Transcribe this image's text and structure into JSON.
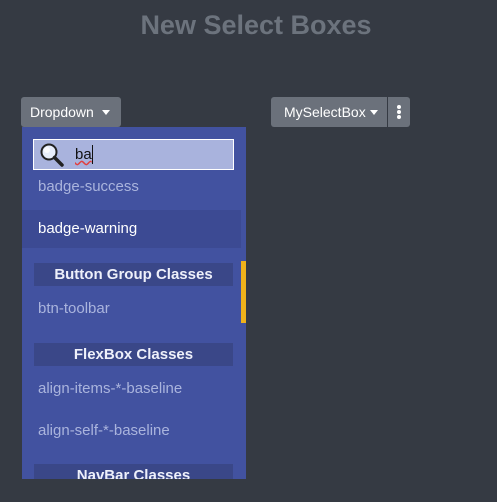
{
  "page": {
    "title": "New Select Boxes"
  },
  "buttons": {
    "dropdown_label": "Dropdown",
    "myselectbox_label": "MySelectBox"
  },
  "dropdown_menu": {
    "search_value": "ba",
    "items": [
      {
        "label": "badge-success",
        "type": "item"
      },
      {
        "label": "badge-warning",
        "type": "item",
        "highlighted": true
      },
      {
        "label": "Button Group Classes",
        "type": "group"
      },
      {
        "label": "btn-toolbar",
        "type": "item"
      },
      {
        "label": "FlexBox Classes",
        "type": "group"
      },
      {
        "label": "align-items-*-baseline",
        "type": "item"
      },
      {
        "label": "align-self-*-baseline",
        "type": "item"
      },
      {
        "label": "NavBar Classes",
        "type": "group"
      }
    ]
  },
  "colors": {
    "background": "#353a43",
    "panel": "#4252a0",
    "accent": "#f0b21a"
  }
}
